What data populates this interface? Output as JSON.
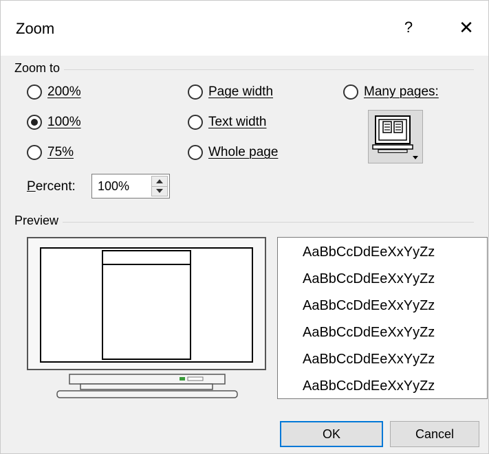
{
  "window": {
    "title": "Zoom",
    "help": "?",
    "close": "✕"
  },
  "zoom_to": {
    "label": "Zoom to",
    "options": [
      {
        "label": "200%",
        "selected": false
      },
      {
        "label": "100%",
        "selected": true
      },
      {
        "label": "75%",
        "selected": false
      },
      {
        "label": "Page width",
        "selected": false
      },
      {
        "label": "Text width",
        "selected": false
      },
      {
        "label": "Whole page",
        "selected": false
      },
      {
        "label": "Many pages:",
        "selected": false
      }
    ],
    "percent_label": "Percent:",
    "percent_value": "100%"
  },
  "preview": {
    "label": "Preview",
    "sample_lines": [
      "AaBbCcDdEeXxYyZz",
      "AaBbCcDdEeXxYyZz",
      "AaBbCcDdEeXxYyZz",
      "AaBbCcDdEeXxYyZz",
      "AaBbCcDdEeXxYyZz",
      "AaBbCcDdEeXxYyZz"
    ]
  },
  "buttons": {
    "ok": "OK",
    "cancel": "Cancel"
  },
  "icons": {
    "help": "help-icon",
    "close": "close-icon",
    "many_pages": "many-pages-icon",
    "spin_up": "spin-up-icon",
    "spin_down": "spin-down-icon"
  },
  "colors": {
    "accent": "#0078d7",
    "dialog_bg": "#f0f0f0"
  }
}
